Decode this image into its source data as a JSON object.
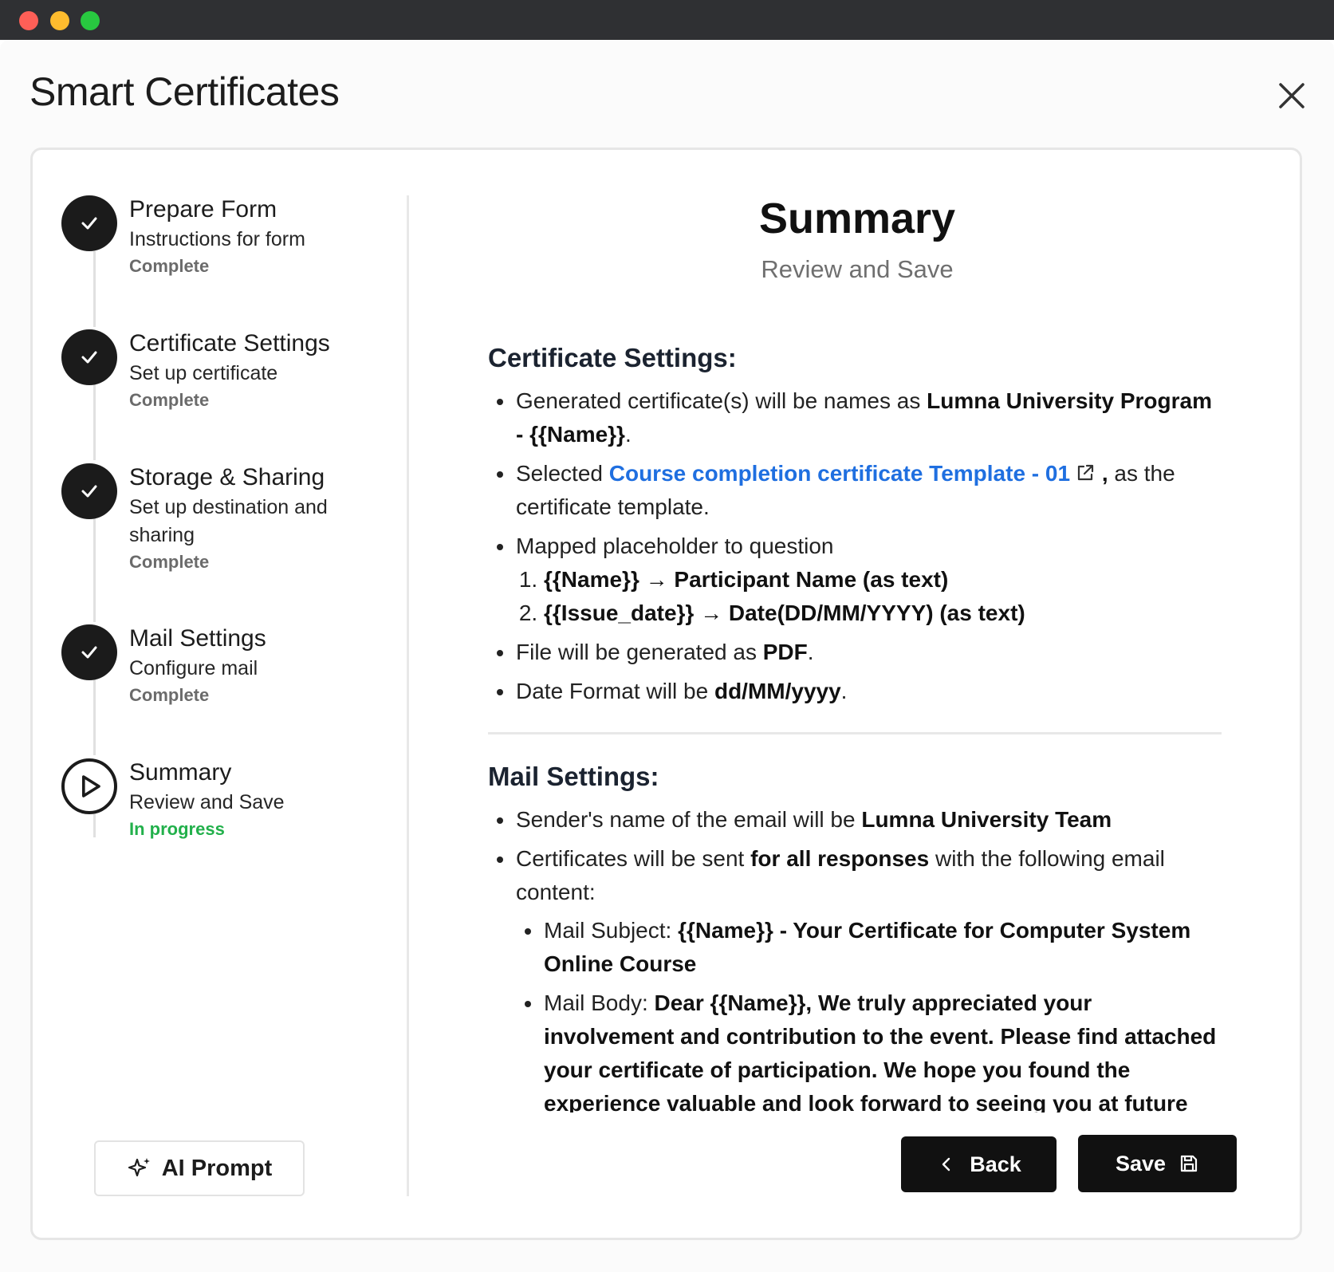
{
  "app": {
    "title": "Smart Certificates"
  },
  "steps": [
    {
      "title": "Prepare Form",
      "subtitle": "Instructions for form",
      "status": "Complete"
    },
    {
      "title": "Certificate Settings",
      "subtitle": "Set up certificate",
      "status": "Complete"
    },
    {
      "title": "Storage & Sharing",
      "subtitle": "Set up destination and sharing",
      "status": "Complete"
    },
    {
      "title": "Mail Settings",
      "subtitle": "Configure mail",
      "status": "Complete"
    },
    {
      "title": "Summary",
      "subtitle": "Review and Save",
      "status": "In progress"
    }
  ],
  "ai_prompt": {
    "label": "AI Prompt"
  },
  "summary": {
    "title": "Summary",
    "subtitle": "Review and Save",
    "certificate": {
      "heading": "Certificate Settings:",
      "name_prefix": "Generated certificate(s) will be names as ",
      "name_value": "Lumna University Program - {{Name}}",
      "name_suffix": ".",
      "template_prefix": "Selected ",
      "template_link": "Course completion certificate Template - 01",
      "template_suffix_bold": ",",
      "template_suffix": " as the certificate template.",
      "mapping_intro": "Mapped placeholder to question",
      "mappings": [
        "{{Name}} → Participant Name (as text)",
        "{{Issue_date}} → Date(DD/MM/YYYY) (as text)"
      ],
      "file_prefix": "File will be generated as ",
      "file_value": "PDF",
      "file_suffix": ".",
      "date_prefix": "Date Format will be ",
      "date_value": "dd/MM/yyyy",
      "date_suffix": "."
    },
    "mail": {
      "heading": "Mail Settings:",
      "sender_prefix": "Sender's name of the email will be ",
      "sender_value": "Lumna University Team",
      "send_prefix": "Certificates will be sent ",
      "send_value": "for all responses",
      "send_suffix": " with the following email content:",
      "subject_label": "Mail Subject: ",
      "subject_value": "{{Name}} - Your Certificate for Computer System Online Course",
      "body_label": "Mail Body: ",
      "body_value": "Dear {{Name}}, We truly appreciated your involvement and contribution to the event. Please find attached your certificate of participation. We hope you found the experience valuable and look forward to seeing you at future events."
    }
  },
  "buttons": {
    "back": "Back",
    "save": "Save"
  },
  "colors": {
    "link": "#1f6fe0",
    "in_progress": "#22b04b",
    "dark": "#111111"
  }
}
